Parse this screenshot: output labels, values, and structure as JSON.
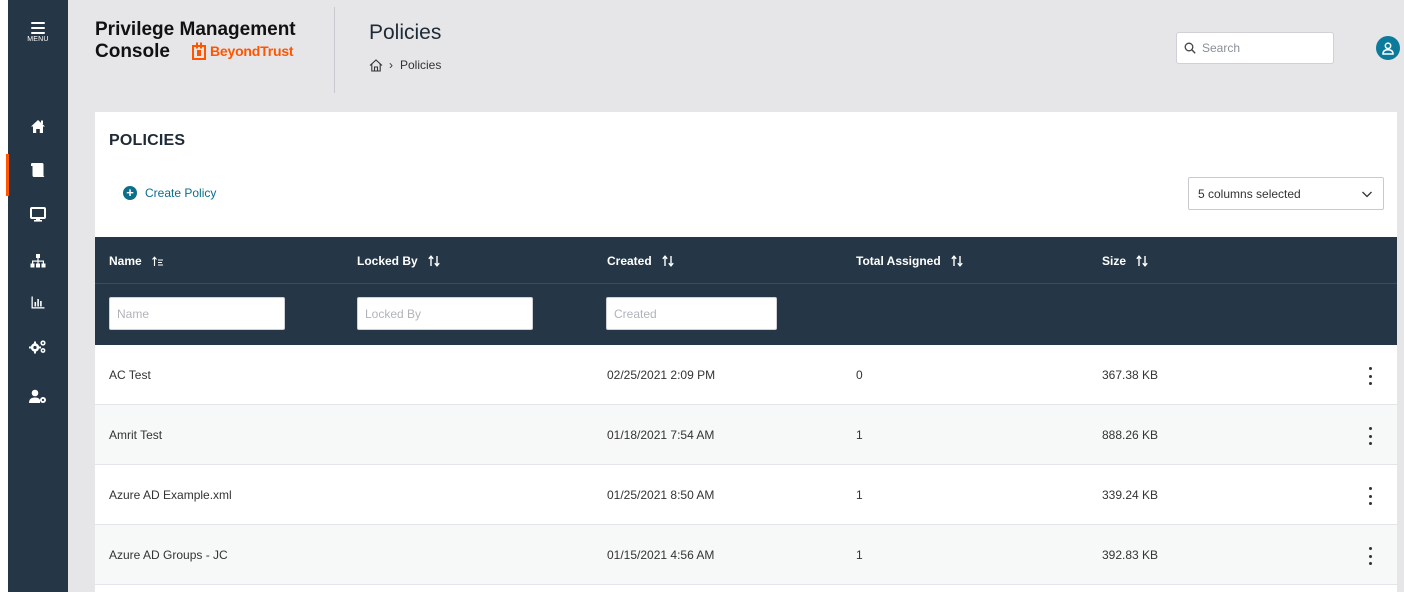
{
  "app": {
    "title_line1": "Privilege Management",
    "title_line2": "Console",
    "brand": "BeyondTrust",
    "brand_color": "#ff5500",
    "sidebar_color": "#253746"
  },
  "sidebar": {
    "menu_label": "MENU",
    "items": [
      {
        "icon": "home-icon"
      },
      {
        "icon": "policies-icon",
        "active": true
      },
      {
        "icon": "computer-icon"
      },
      {
        "icon": "hierarchy-icon"
      },
      {
        "icon": "reports-icon"
      },
      {
        "icon": "gears-icon"
      },
      {
        "icon": "user-settings-icon"
      }
    ]
  },
  "header": {
    "page_title": "Policies",
    "breadcrumb": {
      "home_icon": "home-outline-icon",
      "current": "Policies"
    },
    "search": {
      "placeholder": "Search",
      "value": ""
    },
    "avatar_icon": "user-icon"
  },
  "main": {
    "title": "POLICIES",
    "create_label": "Create Policy",
    "columns_select": {
      "value": "5 columns selected"
    },
    "table": {
      "columns": [
        {
          "label": "Name",
          "sort_icon": "sort-ascending-icon"
        },
        {
          "label": "Locked By",
          "sort_icon": "sort-icon"
        },
        {
          "label": "Created",
          "sort_icon": "sort-icon"
        },
        {
          "label": "Total Assigned",
          "sort_icon": "sort-icon"
        },
        {
          "label": "Size",
          "sort_icon": "sort-icon"
        }
      ],
      "filters": {
        "name": {
          "placeholder": "Name",
          "value": ""
        },
        "locked_by": {
          "placeholder": "Locked By",
          "value": ""
        },
        "created": {
          "placeholder": "Created",
          "value": ""
        }
      },
      "rows": [
        {
          "name": "AC Test",
          "locked_by": "",
          "created": "02/25/2021 2:09 PM",
          "total_assigned": "0",
          "size": "367.38 KB"
        },
        {
          "name": "Amrit Test",
          "locked_by": "",
          "created": "01/18/2021 7:54 AM",
          "total_assigned": "1",
          "size": "888.26 KB"
        },
        {
          "name": "Azure AD Example.xml",
          "locked_by": "",
          "created": "01/25/2021 8:50 AM",
          "total_assigned": "1",
          "size": "339.24 KB"
        },
        {
          "name": "Azure AD Groups - JC",
          "locked_by": "",
          "created": "01/15/2021 4:56 AM",
          "total_assigned": "1",
          "size": "392.83 KB"
        }
      ]
    }
  }
}
